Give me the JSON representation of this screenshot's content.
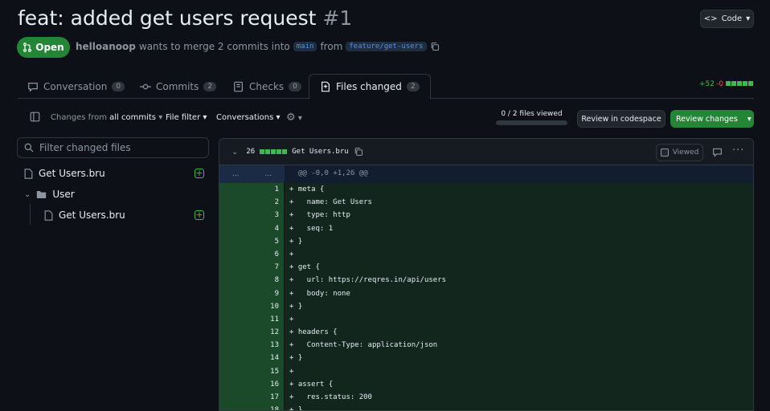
{
  "pr": {
    "title": "feat: added get users request",
    "number": "#1",
    "status": "Open",
    "author": "helloanoop",
    "merge_text": "wants to merge 2 commits into",
    "base_branch": "main",
    "from_text": "from",
    "head_branch": "feature/get-users"
  },
  "header": {
    "code_label": "Code"
  },
  "tabs": [
    {
      "label": "Conversation",
      "count": "0"
    },
    {
      "label": "Commits",
      "count": "2"
    },
    {
      "label": "Checks",
      "count": "0"
    },
    {
      "label": "Files changed",
      "count": "2"
    }
  ],
  "diffstat": {
    "additions": "+52",
    "deletions": "-0"
  },
  "toolbar": {
    "changes_prefix": "Changes from",
    "changes_value": "all commits",
    "file_filter": "File filter",
    "conversations": "Conversations",
    "files_viewed": "0 / 2 files viewed",
    "files_viewed_fraction": 0,
    "codespace": "Review in codespace",
    "review": "Review changes"
  },
  "sidebar": {
    "filter_placeholder": "Filter changed files",
    "tree": [
      {
        "type": "file",
        "name": "Get Users.bru",
        "depth": 0
      },
      {
        "type": "folder",
        "name": "User",
        "depth": 0
      },
      {
        "type": "file",
        "name": "Get Users.bru",
        "depth": 1
      }
    ]
  },
  "diff": {
    "count": "26",
    "filename": "Get Users.bru",
    "viewed_label": "Viewed",
    "hunk_gutter_left": "...",
    "hunk_gutter_right": "...",
    "hunk_header": "@@ -0,0 +1,26 @@",
    "lines": [
      {
        "n": "1",
        "code": "+ meta {"
      },
      {
        "n": "2",
        "code": "+   name: Get Users"
      },
      {
        "n": "3",
        "code": "+   type: http"
      },
      {
        "n": "4",
        "code": "+   seq: 1"
      },
      {
        "n": "5",
        "code": "+ }"
      },
      {
        "n": "6",
        "code": "+"
      },
      {
        "n": "7",
        "code": "+ get {"
      },
      {
        "n": "8",
        "code": "+   url: https://reqres.in/api/users"
      },
      {
        "n": "9",
        "code": "+   body: none"
      },
      {
        "n": "10",
        "code": "+ }"
      },
      {
        "n": "11",
        "code": "+"
      },
      {
        "n": "12",
        "code": "+ headers {"
      },
      {
        "n": "13",
        "code": "+   Content-Type: application/json"
      },
      {
        "n": "14",
        "code": "+ }"
      },
      {
        "n": "15",
        "code": "+"
      },
      {
        "n": "16",
        "code": "+ assert {"
      },
      {
        "n": "17",
        "code": "+   res.status: 200"
      },
      {
        "n": "18",
        "code": "+ }"
      }
    ]
  }
}
